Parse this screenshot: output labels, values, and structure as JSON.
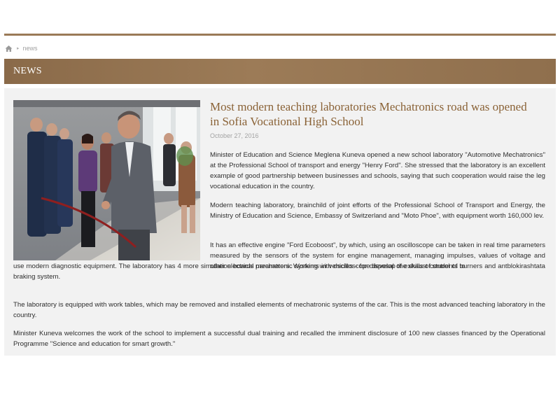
{
  "breadcrumb": {
    "home_icon": "home-icon",
    "separator": "▸",
    "current": "news"
  },
  "section": {
    "title": "NEWS"
  },
  "article": {
    "title": "Most modern teaching laboratories Mechatronics road was opened in Sofia Vocational High School",
    "date": "October 27, 2016",
    "p1": "Minister of Education and Science Meglena Kuneva opened a new school laboratory \"Automotive Mechatronics\" at the Professional School of transport and energy \"Henry Ford\". She stressed that the laboratory is an excellent example of good partnership between businesses and schools, saying that such cooperation would raise the leg vocational education in the country.",
    "p2": "Modern teaching laboratory, brainchild of joint efforts of the Professional School of Transport and Energy, the Ministry of Education and Science, Embassy of Switzerland and \"Moto Phoe\", with equipment worth 160,000 lev.",
    "p3a": "It has an effective engine \"Ford Ecoboost\", by which, using an oscilloscope can be taken in real time parameters measured by the sensors of the system for engine management, managing impulses, values of voltage and other electrical parameters. Working with oscilloscope develop the skills of students to",
    "p3b": "use modern diagnostic equipment. The laboratory has 4 more simulation boards mechatronic systems in vehicles - for disposal of exhaust control of burners and antblokirashtata braking system.",
    "p4": "The laboratory is equipped with work tables, which may be removed and installed elements of mechatronic systems of the car. This is the most advanced teaching laboratory in the country.",
    "p5": "Minister Kuneva welcomes the work of the school to implement a successful dual training and recalled the imminent disclosure of 100 new classes financed by the Operational Programme \"Science and education for smart growth.\""
  },
  "colors": {
    "accent": "#9a7a57",
    "title": "#8a6236",
    "panel": "#f2f2f2"
  }
}
